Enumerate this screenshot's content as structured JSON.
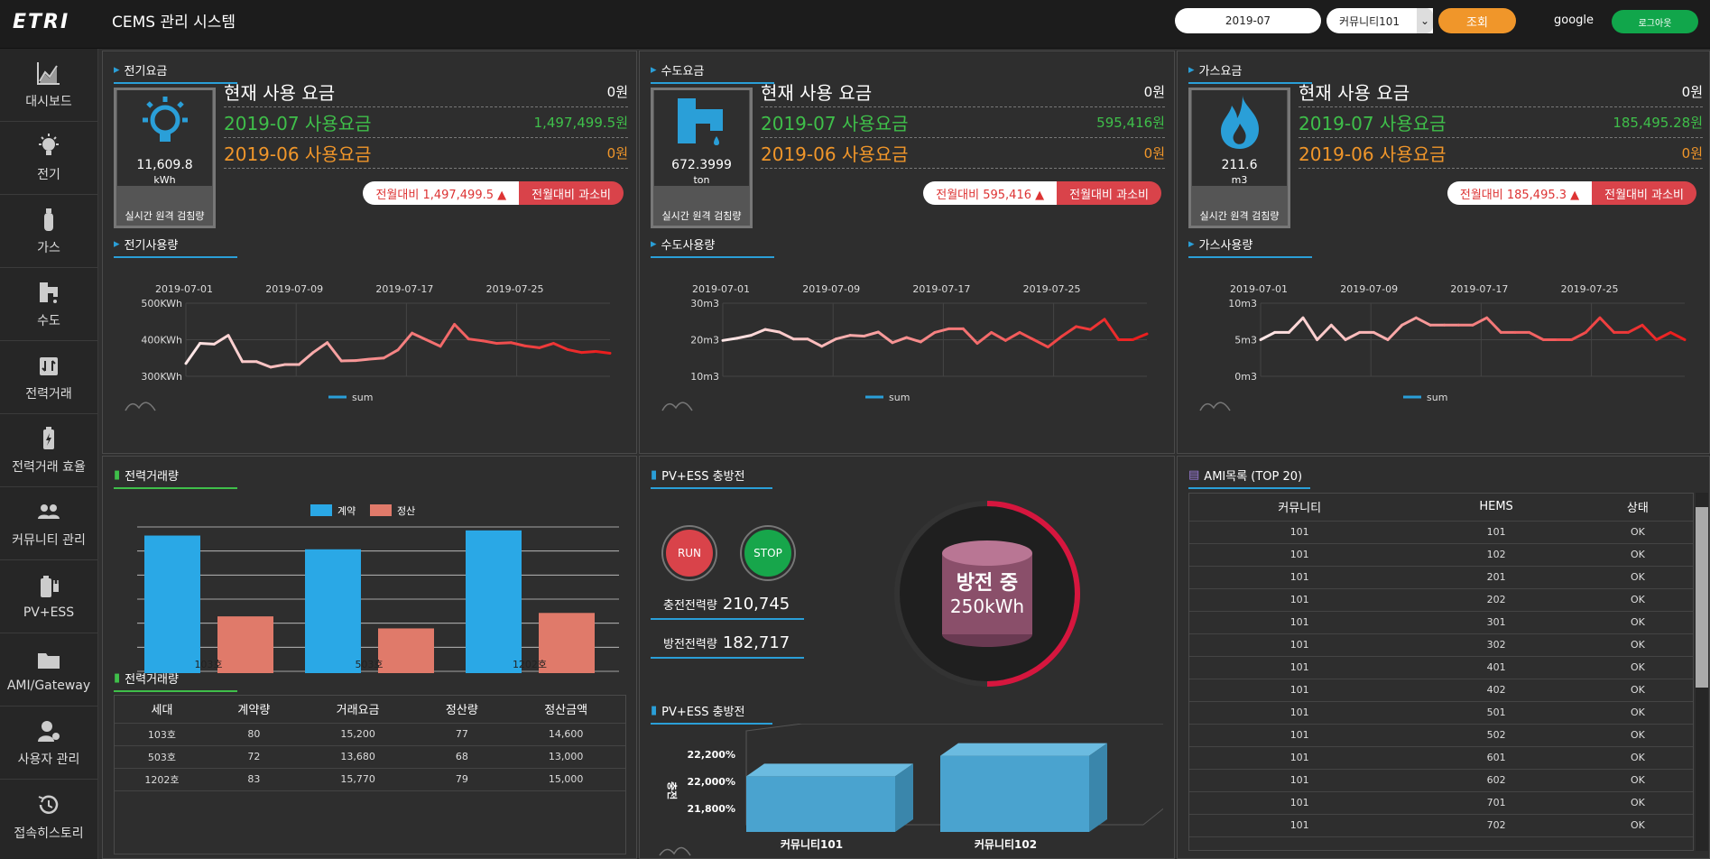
{
  "header": {
    "logo": "ETRI",
    "title": "CEMS 관리 시스템",
    "date": "2019-07",
    "community": "커뮤니티101",
    "search_label": "조회",
    "user": "google",
    "logout_label": "로그아웃"
  },
  "sidebar": {
    "items": [
      {
        "label": "대시보드",
        "icon": "chart-line-icon"
      },
      {
        "label": "전기",
        "icon": "lightbulb-icon"
      },
      {
        "label": "가스",
        "icon": "gas-cylinder-icon"
      },
      {
        "label": "수도",
        "icon": "faucet-icon"
      },
      {
        "label": "전력거래",
        "icon": "exchange-icon"
      },
      {
        "label": "전력거래 효율",
        "icon": "battery-bolt-icon"
      },
      {
        "label": "커뮤니티 관리",
        "icon": "users-icon"
      },
      {
        "label": "PV+ESS",
        "icon": "battery-plug-icon"
      },
      {
        "label": "AMI/Gateway",
        "icon": "folder-icon"
      },
      {
        "label": "사용자 관리",
        "icon": "user-cog-icon"
      },
      {
        "label": "접속히스토리",
        "icon": "history-icon"
      }
    ]
  },
  "utilities": [
    {
      "key": "elec",
      "fee_title": "전기요금",
      "usage_title": "전기사용량",
      "gauge_value": "11,609.8",
      "gauge_unit": "kWh",
      "gauge_label": "실시간 원격 검침량",
      "current_label": "현재 사용 요금",
      "current_value": "0원",
      "this_label": "2019-07 사용요금",
      "this_value": "1,497,499.5원",
      "prev_label": "2019-06 사용요금",
      "prev_value": "0원",
      "diff": "전월대비 1,497,499.5 ▲",
      "over": "전월대비 과소비",
      "color": "#2a9fd8"
    },
    {
      "key": "water",
      "fee_title": "수도요금",
      "usage_title": "수도사용량",
      "gauge_value": "672.3999",
      "gauge_unit": "ton",
      "gauge_label": "실시간 원격 검침량",
      "current_label": "현재 사용 요금",
      "current_value": "0원",
      "this_label": "2019-07 사용요금",
      "this_value": "595,416원",
      "prev_label": "2019-06 사용요금",
      "prev_value": "0원",
      "diff": "전월대비 595,416 ▲",
      "over": "전월대비 과소비",
      "color": "#2a9fd8"
    },
    {
      "key": "gas",
      "fee_title": "가스요금",
      "usage_title": "가스사용량",
      "gauge_value": "211.6",
      "gauge_unit": "m3",
      "gauge_label": "실시간 원격 검침량",
      "current_label": "현재 사용 요금",
      "current_value": "0원",
      "this_label": "2019-07 사용요금",
      "this_value": "185,495.28원",
      "prev_label": "2019-06 사용요금",
      "prev_value": "0원",
      "diff": "전월대비 185,495.3 ▲",
      "over": "전월대비 과소비",
      "color": "#2a9fd8"
    }
  ],
  "colors": {
    "green": "#3fbf4a",
    "orange": "#f0962a",
    "accent": "#2a9fd8",
    "red": "#e03b3b"
  },
  "chart_data": [
    {
      "type": "line",
      "title": "전기사용량",
      "x_ticks": [
        "2019-07-01",
        "2019-07-09",
        "2019-07-17",
        "2019-07-25"
      ],
      "y_ticks": [
        "500KWh",
        "400KWh",
        "300KWh"
      ],
      "ylim": [
        300,
        500
      ],
      "legend": "sum",
      "values": [
        335,
        390,
        388,
        412,
        340,
        340,
        325,
        332,
        332,
        365,
        392,
        342,
        343,
        347,
        350,
        372,
        418,
        400,
        382,
        442,
        402,
        397,
        390,
        392,
        383,
        378,
        390,
        373,
        365,
        368,
        363
      ]
    },
    {
      "type": "line",
      "title": "수도사용량",
      "x_ticks": [
        "2019-07-01",
        "2019-07-09",
        "2019-07-17",
        "2019-07-25"
      ],
      "y_ticks": [
        "30m3",
        "20m3",
        "10m3"
      ],
      "ylim": [
        10,
        30
      ],
      "legend": "sum",
      "values": [
        19.8,
        20.4,
        21.2,
        22.8,
        22.1,
        20.2,
        20.2,
        18.2,
        20.2,
        21.2,
        21.0,
        22.1,
        19.2,
        20.6,
        19.4,
        22.0,
        23.0,
        23.0,
        19.0,
        22.0,
        19.8,
        22.0,
        20.0,
        18.0,
        21.0,
        23.6,
        22.8,
        25.6,
        20.0,
        20.0,
        21.6
      ]
    },
    {
      "type": "line",
      "title": "가스사용량",
      "x_ticks": [
        "2019-07-01",
        "2019-07-09",
        "2019-07-17",
        "2019-07-25"
      ],
      "y_ticks": [
        "10m3",
        "5m3",
        "0m3"
      ],
      "ylim": [
        0,
        10
      ],
      "legend": "sum",
      "values": [
        5,
        6,
        6,
        8,
        5,
        7,
        5,
        6,
        6,
        5,
        7,
        8,
        7,
        7,
        7,
        7,
        8,
        6,
        6,
        6,
        5,
        5,
        5,
        6,
        8,
        6,
        6,
        7,
        5,
        6,
        5
      ]
    },
    {
      "type": "bar",
      "title": "전력거래량",
      "categories": [
        "103호",
        "503호",
        "1202호"
      ],
      "series": [
        {
          "name": "계약",
          "values": [
            80,
            72,
            83
          ]
        },
        {
          "name": "정산",
          "values": [
            33,
            26,
            35
          ]
        }
      ],
      "ylim": [
        0,
        85
      ]
    },
    {
      "type": "bar",
      "title": "PV+ESS 충방전",
      "categories": [
        "커뮤니티101",
        "커뮤니티102"
      ],
      "ylabel": "충전",
      "y_ticks": [
        "22,200%",
        "22,000%",
        "21,800%"
      ],
      "values": [
        21990,
        22085
      ],
      "ylim": [
        21800,
        22200
      ]
    }
  ],
  "trade_table": {
    "title": "전력거래량",
    "headers": [
      "세대",
      "계약량",
      "거래요금",
      "정산량",
      "정산금액"
    ],
    "rows": [
      [
        "103호",
        "80",
        "15,200",
        "77",
        "14,600"
      ],
      [
        "503호",
        "72",
        "13,680",
        "68",
        "13,000"
      ],
      [
        "1202호",
        "83",
        "15,770",
        "79",
        "15,000"
      ]
    ]
  },
  "ess": {
    "title": "PV+ESS 충방전",
    "title2": "PV+ESS 충방전",
    "run": "RUN",
    "stop": "STOP",
    "charge_label": "충전전력량",
    "charge_value": "210,745",
    "discharge_label": "방전전력량",
    "discharge_value": "182,717",
    "status": "방전 중",
    "status_value": "250kWh"
  },
  "ami": {
    "title": "AMI목록 (TOP 20)",
    "headers": [
      "커뮤니티",
      "HEMS",
      "상태"
    ],
    "rows": [
      [
        "101",
        "101",
        "OK"
      ],
      [
        "101",
        "102",
        "OK"
      ],
      [
        "101",
        "201",
        "OK"
      ],
      [
        "101",
        "202",
        "OK"
      ],
      [
        "101",
        "301",
        "OK"
      ],
      [
        "101",
        "302",
        "OK"
      ],
      [
        "101",
        "401",
        "OK"
      ],
      [
        "101",
        "402",
        "OK"
      ],
      [
        "101",
        "501",
        "OK"
      ],
      [
        "101",
        "502",
        "OK"
      ],
      [
        "101",
        "601",
        "OK"
      ],
      [
        "101",
        "602",
        "OK"
      ],
      [
        "101",
        "701",
        "OK"
      ],
      [
        "101",
        "702",
        "OK"
      ]
    ]
  }
}
